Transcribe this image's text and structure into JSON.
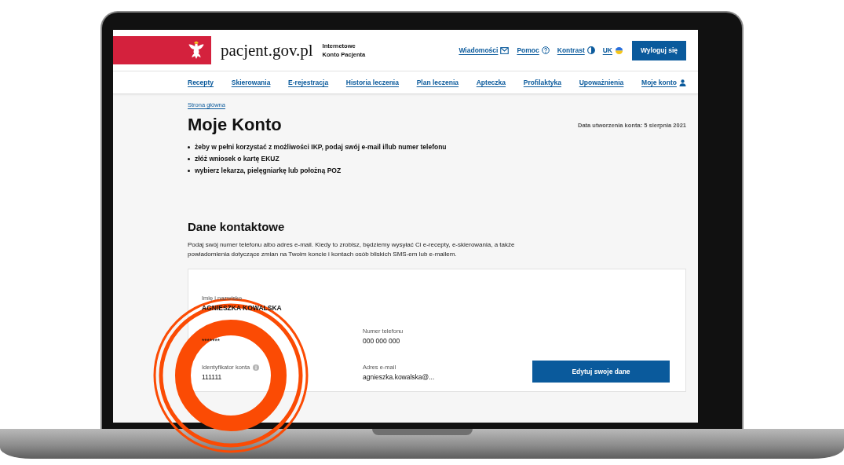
{
  "header": {
    "logo_text": "pacjent.gov.pl",
    "subtitle_lines": [
      "Internetowe",
      "Konto Pacjenta"
    ],
    "links": [
      {
        "label": "Wiadomości"
      },
      {
        "label": "Pomoc"
      },
      {
        "label": "Kontrast"
      },
      {
        "label": "UK"
      }
    ],
    "logout_button": "Wyloguj się"
  },
  "nav": [
    {
      "label": "Recepty"
    },
    {
      "label": "Skierowania"
    },
    {
      "label": "E-rejestracja"
    },
    {
      "label": "Historia leczenia"
    },
    {
      "label": "Plan leczenia"
    },
    {
      "label": "Apteczka"
    },
    {
      "label": "Profilaktyka"
    },
    {
      "label": "Upoważnienia"
    },
    {
      "label": "Moje konto"
    }
  ],
  "breadcrumb": "Strona główna",
  "title": "Moje Konto",
  "created": "Data utworzenia konta: 5 sierpnia 2021",
  "bullets": [
    "żeby w pełni korzystać z możliwości IKP, podaj swój e-mail i/lub numer telefonu",
    "złóż wniosek o kartę EKUZ",
    "wybierz lekarza, pielęgniarkę lub położną POZ"
  ],
  "contact": {
    "heading": "Dane kontaktowe",
    "description": "Podaj swój numer telefonu albo adres e-mail. Kiedy to zrobisz, będziemy wysyłać Ci e-recepty, e-skierowania, a także powiadomienia dotyczące zmian na Twoim koncie i kontach osób bliskich SMS-em lub e-mailem.",
    "rows": [
      [
        {
          "label": "Imię i nazwisko",
          "value": "AGNIESZKA KOWALSKA",
          "bold": true
        }
      ],
      [
        {
          "value": "*******"
        },
        {
          "label": "Numer telefonu",
          "value": "000 000 000"
        }
      ],
      [
        {
          "label": "Identyfikator konta",
          "value": "111111",
          "info": true
        },
        {
          "label": "Adres e-mail",
          "value": "agnieszka.kowalska@..."
        }
      ]
    ],
    "edit_button": "Edytuj swoje dane"
  }
}
